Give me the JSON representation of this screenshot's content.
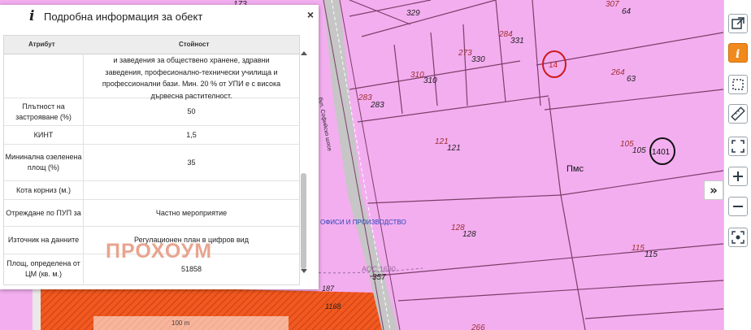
{
  "panel": {
    "title": "Подробна информация за обект",
    "close": "×",
    "headers": {
      "attribute": "Атрибут",
      "value": "Стойност"
    },
    "description_lines": [
      "и заведения за обществено хранене, здравни",
      "заведения, професионално-технически училища и",
      "профессионални бази. Мин. 20 % от УПИ е с висока",
      "дървесна растителност."
    ],
    "rows": [
      {
        "attribute": "Плътност на застрояване (%)",
        "value": "50"
      },
      {
        "attribute": "КИНТ",
        "value": "1,5"
      },
      {
        "attribute": "Мининална озеленена площ (%)",
        "value": "35"
      },
      {
        "attribute": "Кота корниз (м.)",
        "value": ""
      },
      {
        "attribute": "Отреждане по ПУП за",
        "value": "Частно мероприятие"
      },
      {
        "attribute": "Източник на данните",
        "value": "Регулационен план в цифров вид"
      },
      {
        "attribute": "Площ, определена от ЦМ (кв. м.)",
        "value": "51858"
      }
    ],
    "watermark": "ПРОХОУМ"
  },
  "map": {
    "parcel_labels": [
      {
        "text": "173"
      },
      {
        "text": "329"
      },
      {
        "text": "307"
      },
      {
        "text": "64"
      },
      {
        "text": "284"
      },
      {
        "text": "331"
      },
      {
        "text": "273"
      },
      {
        "text": "330"
      },
      {
        "text": "14"
      },
      {
        "text": "264"
      },
      {
        "text": "63"
      },
      {
        "text": "310"
      },
      {
        "text": "310"
      },
      {
        "text": "283"
      },
      {
        "text": "283"
      },
      {
        "text": "121"
      },
      {
        "text": "121"
      },
      {
        "text": "105"
      },
      {
        "text": "105"
      },
      {
        "text": "1401"
      },
      {
        "text": "Пмс"
      },
      {
        "text": "128"
      },
      {
        "text": "128"
      },
      {
        "text": "115"
      },
      {
        "text": "115"
      },
      {
        "text": "357"
      },
      {
        "text": "266"
      },
      {
        "text": "187"
      },
      {
        "text": "1168"
      }
    ],
    "road_label": "бул. Софийско шосе",
    "zone_label": "ОФИСИ И ПРОИЗВОДСТВО",
    "route_label": "АОС 1690",
    "scale_label": "100 m",
    "colors": {
      "parcel_fill": "#f3aef0",
      "boundary": "#7a3f68",
      "road": "#c6c6c6",
      "hatch": "#f2591e",
      "red_circle": "#cc1a1a"
    }
  },
  "toolbar": {
    "expand_label": "»",
    "tools": [
      {
        "name": "open-external-icon"
      },
      {
        "name": "info-icon"
      },
      {
        "name": "select-area-icon"
      },
      {
        "name": "measure-ruler-icon"
      },
      {
        "name": "fullscreen-icon"
      },
      {
        "name": "zoom-in-icon"
      },
      {
        "name": "zoom-out-icon"
      },
      {
        "name": "locate-icon"
      }
    ]
  }
}
